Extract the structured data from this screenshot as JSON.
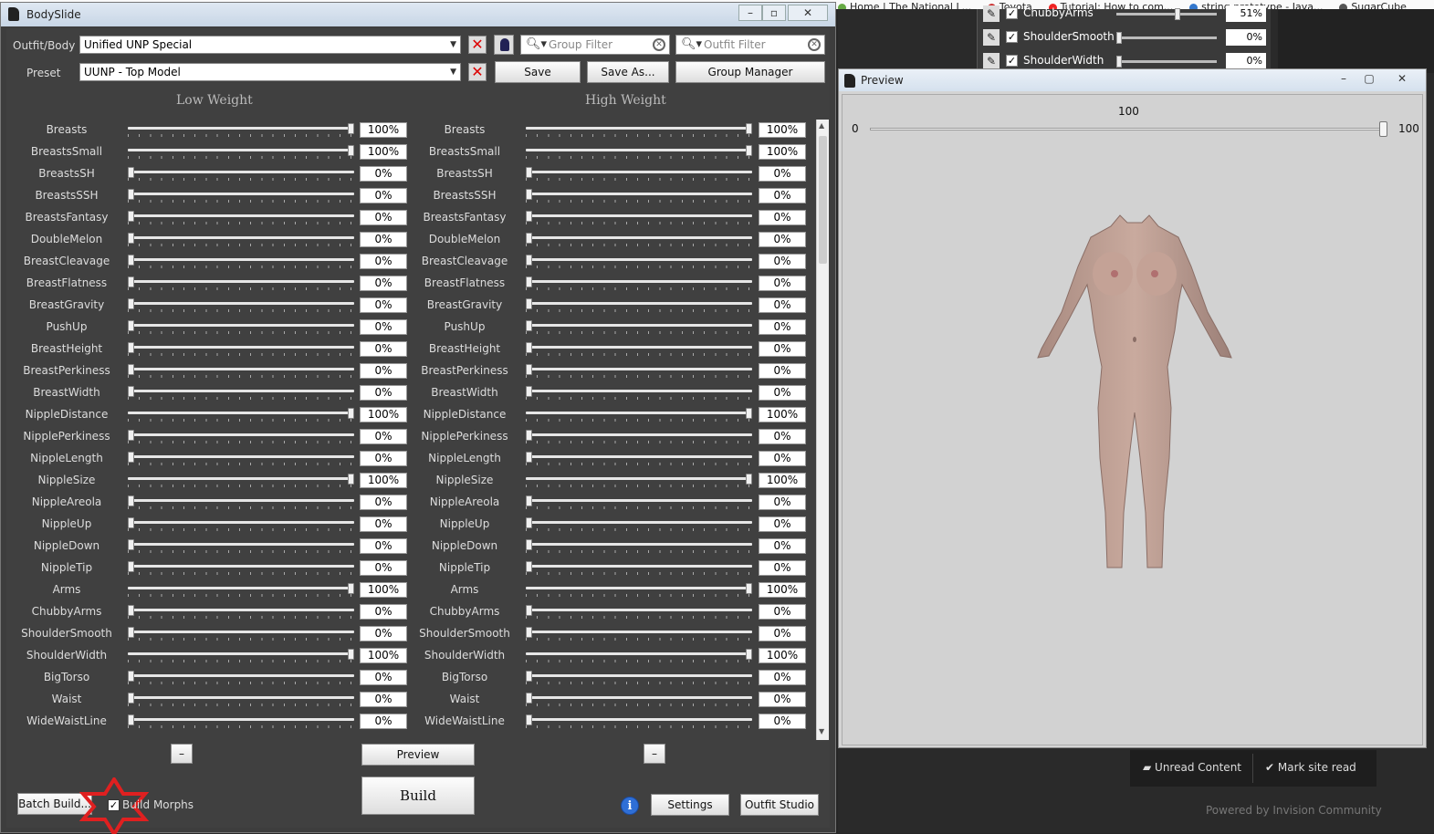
{
  "browser": {
    "tabs": [
      "Home | The National L...",
      "Toyota",
      "Tutorial: How to com...",
      "string.prototype - Java...",
      "SugarCube"
    ],
    "bg_sliders": [
      {
        "name": "ChubbyArms",
        "value": "51%"
      },
      {
        "name": "ShoulderSmooth",
        "value": "0%"
      },
      {
        "name": "ShoulderWidth",
        "value": "0%"
      }
    ],
    "forum": {
      "unread_content": "Unread Content",
      "mark_site_read": "Mark site read",
      "powered_by": "Powered by Invision Community"
    }
  },
  "bodyslide": {
    "title": "BodySlide",
    "outfit_label": "Outfit/Body",
    "outfit_value": "Unified UNP Special",
    "preset_label": "Preset",
    "preset_value": "UUNP - Top Model",
    "group_filter_placeholder": "Group Filter",
    "outfit_filter_placeholder": "Outfit Filter",
    "save_label": "Save",
    "save_as_label": "Save As...",
    "group_manager_label": "Group Manager",
    "low_weight_header": "Low Weight",
    "high_weight_header": "High Weight",
    "sliders": [
      {
        "name": "Breasts",
        "low": "100%",
        "high": "100%"
      },
      {
        "name": "BreastsSmall",
        "low": "100%",
        "high": "100%"
      },
      {
        "name": "BreastsSH",
        "low": "0%",
        "high": "0%"
      },
      {
        "name": "BreastsSSH",
        "low": "0%",
        "high": "0%"
      },
      {
        "name": "BreastsFantasy",
        "low": "0%",
        "high": "0%"
      },
      {
        "name": "DoubleMelon",
        "low": "0%",
        "high": "0%"
      },
      {
        "name": "BreastCleavage",
        "low": "0%",
        "high": "0%"
      },
      {
        "name": "BreastFlatness",
        "low": "0%",
        "high": "0%"
      },
      {
        "name": "BreastGravity",
        "low": "0%",
        "high": "0%"
      },
      {
        "name": "PushUp",
        "low": "0%",
        "high": "0%"
      },
      {
        "name": "BreastHeight",
        "low": "0%",
        "high": "0%"
      },
      {
        "name": "BreastPerkiness",
        "low": "0%",
        "high": "0%"
      },
      {
        "name": "BreastWidth",
        "low": "0%",
        "high": "0%"
      },
      {
        "name": "NippleDistance",
        "low": "100%",
        "high": "100%"
      },
      {
        "name": "NipplePerkiness",
        "low": "0%",
        "high": "0%"
      },
      {
        "name": "NippleLength",
        "low": "0%",
        "high": "0%"
      },
      {
        "name": "NippleSize",
        "low": "100%",
        "high": "100%"
      },
      {
        "name": "NippleAreola",
        "low": "0%",
        "high": "0%"
      },
      {
        "name": "NippleUp",
        "low": "0%",
        "high": "0%"
      },
      {
        "name": "NippleDown",
        "low": "0%",
        "high": "0%"
      },
      {
        "name": "NippleTip",
        "low": "0%",
        "high": "0%"
      },
      {
        "name": "Arms",
        "low": "100%",
        "high": "100%"
      },
      {
        "name": "ChubbyArms",
        "low": "0%",
        "high": "0%"
      },
      {
        "name": "ShoulderSmooth",
        "low": "0%",
        "high": "0%"
      },
      {
        "name": "ShoulderWidth",
        "low": "100%",
        "high": "100%"
      },
      {
        "name": "BigTorso",
        "low": "0%",
        "high": "0%"
      },
      {
        "name": "Waist",
        "low": "0%",
        "high": "0%"
      },
      {
        "name": "WideWaistLine",
        "low": "0%",
        "high": "0%"
      }
    ],
    "preview_label": "Preview",
    "build_label": "Build",
    "batch_build_label": "Batch Build...",
    "build_morphs_label": "Build Morphs",
    "settings_label": "Settings",
    "outfit_studio_label": "Outfit Studio",
    "minus_label": "–"
  },
  "preview": {
    "title": "Preview",
    "weight_value": "100",
    "min_label": "0",
    "max_label": "100",
    "weight_fraction": 1.0
  },
  "colors": {
    "window_bg": "#404040",
    "highlight_star": "#e02020",
    "info_blue": "#2f6fd6"
  }
}
